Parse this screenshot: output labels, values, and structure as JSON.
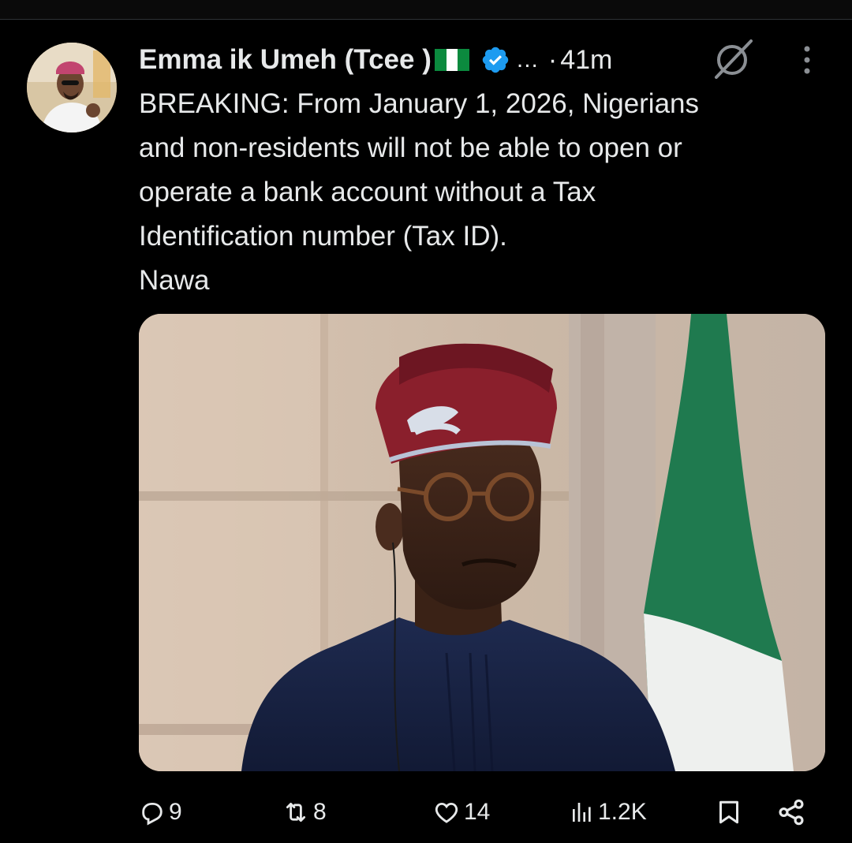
{
  "tweet": {
    "author": {
      "display_name": "Emma ik Umeh (Tcee )",
      "flag_icon": "nigeria-flag-icon",
      "verified_icon": "verified-badge-icon",
      "verified_color": "#1d9bf0",
      "truncation": "..."
    },
    "meta": {
      "separator": "·",
      "timestamp": "41m",
      "grok_icon": "grok-slash-icon",
      "more_icon": "more-vertical-icon"
    },
    "text_lines": [
      "BREAKING: From January 1, 2026, Nigerians",
      "and non-residents will not be able to open or",
      "operate a bank account without a Tax",
      "Identification number (Tax ID).",
      "Nawa"
    ],
    "media": {
      "kind": "photo",
      "flag_colors": {
        "green": "#1f7a4f",
        "white": "#eef0ee"
      }
    },
    "actions": {
      "replies": {
        "icon": "reply-icon",
        "count": "9"
      },
      "reposts": {
        "icon": "repost-icon",
        "count": "8"
      },
      "likes": {
        "icon": "heart-icon",
        "count": "14"
      },
      "views": {
        "icon": "views-chart-icon",
        "count": "1.2K"
      },
      "bookmark": {
        "icon": "bookmark-icon"
      },
      "share": {
        "icon": "share-icon"
      }
    }
  },
  "colors": {
    "background": "#000000",
    "text": "#e7e9ea",
    "verified": "#1d9bf0"
  }
}
